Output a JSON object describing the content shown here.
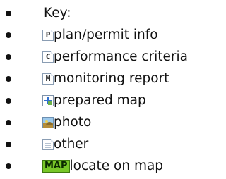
{
  "title": "Key:",
  "items": [
    {
      "icon": "plan-permit-icon",
      "glyph": "P",
      "label": "plan/permit info"
    },
    {
      "icon": "performance-criteria-icon",
      "glyph": "C",
      "label": "performance criteria"
    },
    {
      "icon": "monitoring-report-icon",
      "glyph": "M",
      "label": "monitoring report"
    },
    {
      "icon": "prepared-map-icon",
      "label": "prepared map"
    },
    {
      "icon": "photo-icon",
      "label": "photo"
    },
    {
      "icon": "other-document-icon",
      "label": "other"
    },
    {
      "icon": "map-badge-icon",
      "badge": "MAP",
      "label": "locate on map"
    }
  ],
  "colors": {
    "map_badge": "#78c728",
    "text": "#111111"
  }
}
